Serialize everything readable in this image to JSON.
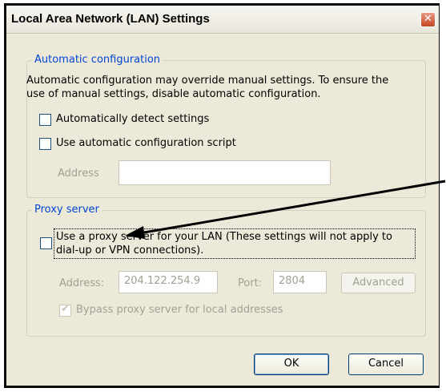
{
  "window": {
    "title": "Local Area Network (LAN) Settings",
    "close_glyph": "✕"
  },
  "auto_config": {
    "legend": "Automatic configuration",
    "description_line1": "Automatic configuration may override manual settings.  To ensure the",
    "description_line2": "use of manual settings, disable automatic configuration.",
    "auto_detect_label": "Automatically detect settings",
    "auto_detect_checked": false,
    "script_label": "Use automatic configuration script",
    "script_checked": false,
    "address_label": "Address",
    "address_value": ""
  },
  "proxy": {
    "legend": "Proxy server",
    "use_proxy_line1": "Use a proxy server for your LAN (These settings will not apply to",
    "use_proxy_line2": "dial-up or VPN connections).",
    "use_proxy_checked": false,
    "address_label": "Address:",
    "address_value": "204.122.254.9",
    "port_label": "Port:",
    "port_value": "2804",
    "advanced_label": "Advanced",
    "bypass_label": "Bypass proxy server for local addresses",
    "bypass_checked": true
  },
  "buttons": {
    "ok_label": "OK",
    "cancel_label": "Cancel"
  },
  "colors": {
    "legend_text": "#0046d5",
    "annotation_arrow": "#000000"
  },
  "icons": {
    "close": "close-icon",
    "check": "checkmark-icon",
    "annotation": "arrow-annotation"
  }
}
